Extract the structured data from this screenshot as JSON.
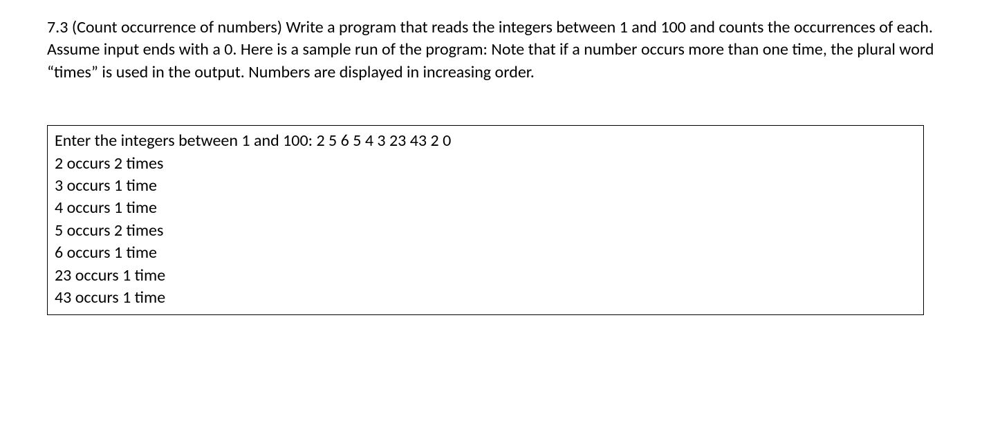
{
  "problem": {
    "text": "7.3 (Count occurrence of numbers) Write a program that reads the integers between 1 and 100 and counts the occurrences of each. Assume input ends with a 0. Here is a sample run of the program: Note that if a number occurs more than one time, the plural word “times” is used in the output.  Numbers are displayed in increasing order."
  },
  "sample": {
    "lines": [
      "Enter the integers between 1 and 100: 2 5 6 5 4 3 23 43 2 0",
      "2 occurs 2 times",
      "3 occurs 1 time",
      "4 occurs 1 time",
      "5 occurs 2 times",
      "6 occurs 1 time",
      "23 occurs 1 time",
      "43 occurs 1 time"
    ]
  }
}
